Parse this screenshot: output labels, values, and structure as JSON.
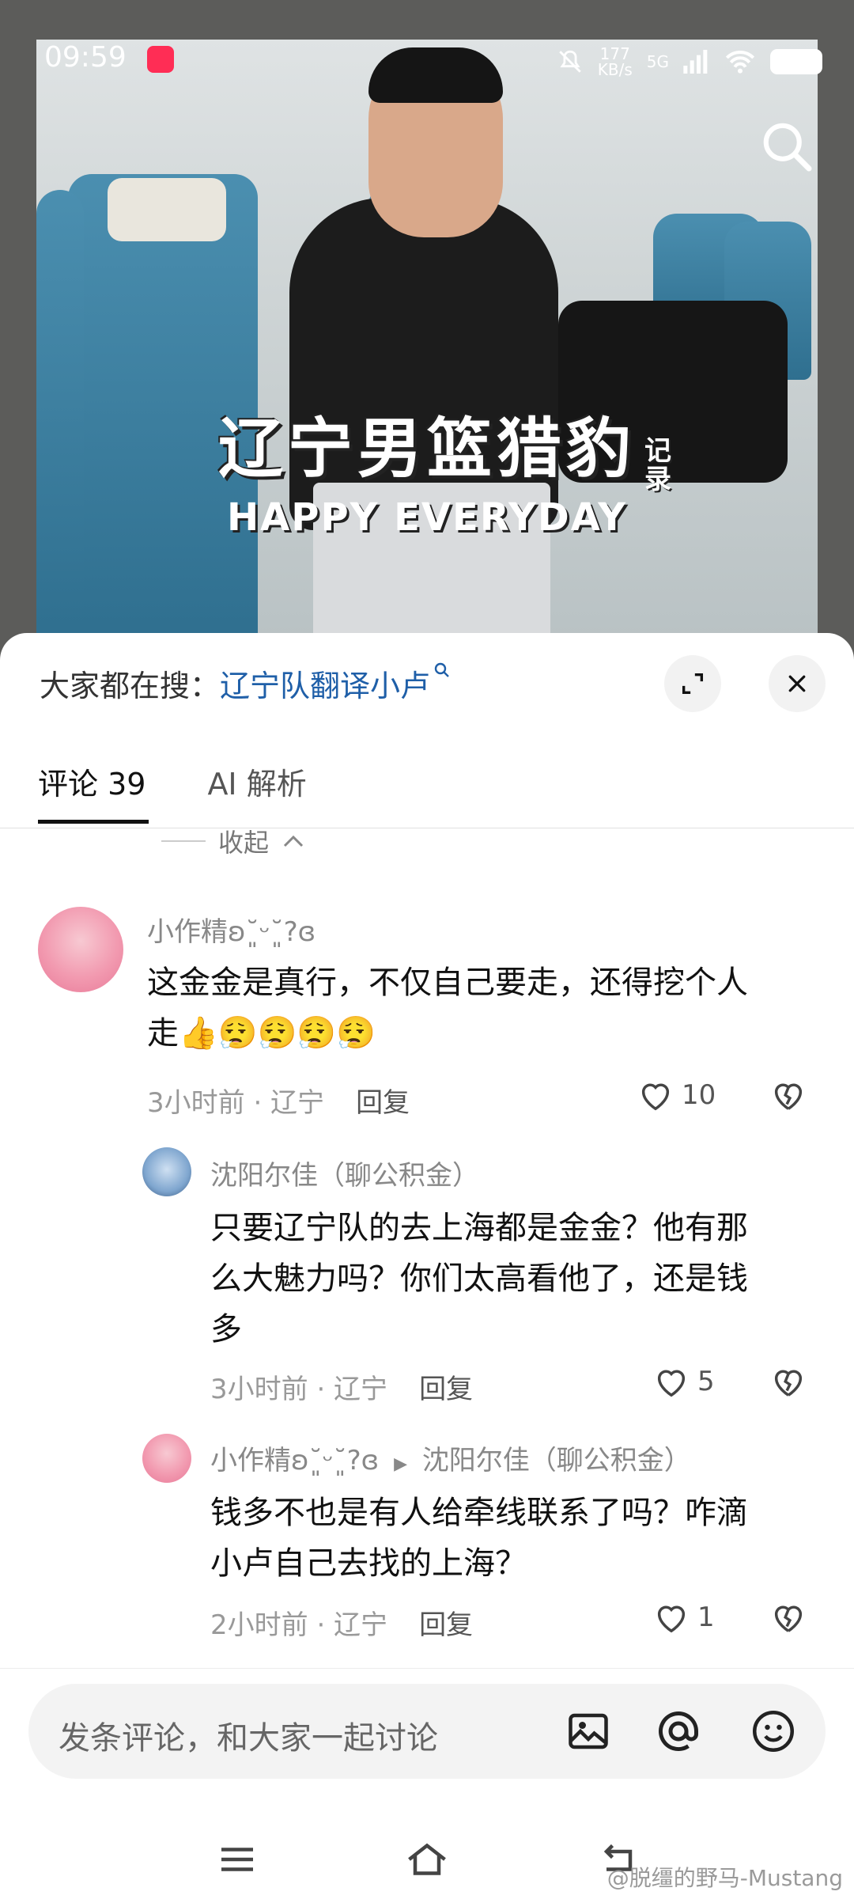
{
  "status_bar": {
    "time": "09:59",
    "net_speed": "177\nKB/s",
    "signal": "5G"
  },
  "video": {
    "title": "辽宁男篮猎豹",
    "title_side": "记录",
    "subtitle": "HAPPY EVERYDAY"
  },
  "sheet": {
    "search_prefix": "大家都在搜：",
    "search_link": "辽宁队翻译小卢",
    "tabs": [
      {
        "label": "评论 39",
        "active": true
      },
      {
        "label": "AI 解析",
        "active": false
      }
    ],
    "collapse_label": "收起"
  },
  "comments": [
    {
      "user": "小作精ʚ˘͈ᵕ˘͈?ɞ",
      "text_line1": "这金金是真行，不仅自己要走，还得挖个人",
      "text_line2": "走👍😮‍💨😮‍💨😮‍💨😮‍💨",
      "time_location": "3小时前 · 辽宁",
      "reply_label": "回复",
      "likes": "10"
    },
    {
      "user": "沈阳尔佳（聊公积金）",
      "text_line1": "只要辽宁队的去上海都是金金？他有那",
      "text_line2": "么大魅力吗？你们太高看他了，还是钱",
      "text_line3": "多",
      "time_location": "3小时前 · 辽宁",
      "reply_label": "回复",
      "likes": "5"
    },
    {
      "user": "小作精ʚ˘͈ᵕ˘͈?ɞ",
      "reply_to_arrow": "▶",
      "reply_to": "沈阳尔佳（聊公积金）",
      "text_line1": "钱多不也是有人给牵线联系了吗？咋滴",
      "text_line2": "小卢自己去找的上海？",
      "time_location": "2小时前 · 辽宁",
      "reply_label": "回复",
      "likes": "1"
    }
  ],
  "composer": {
    "placeholder": "发条评论，和大家一起讨论"
  },
  "watermark": "@脱缰的野马-Mustang",
  "icons": [
    "search-icon",
    "expand-icon",
    "close-icon",
    "chevron-up-icon",
    "heart-icon",
    "broken-heart-icon",
    "image-icon",
    "at-icon",
    "emoji-icon",
    "menu-icon",
    "home-icon",
    "back-icon"
  ]
}
